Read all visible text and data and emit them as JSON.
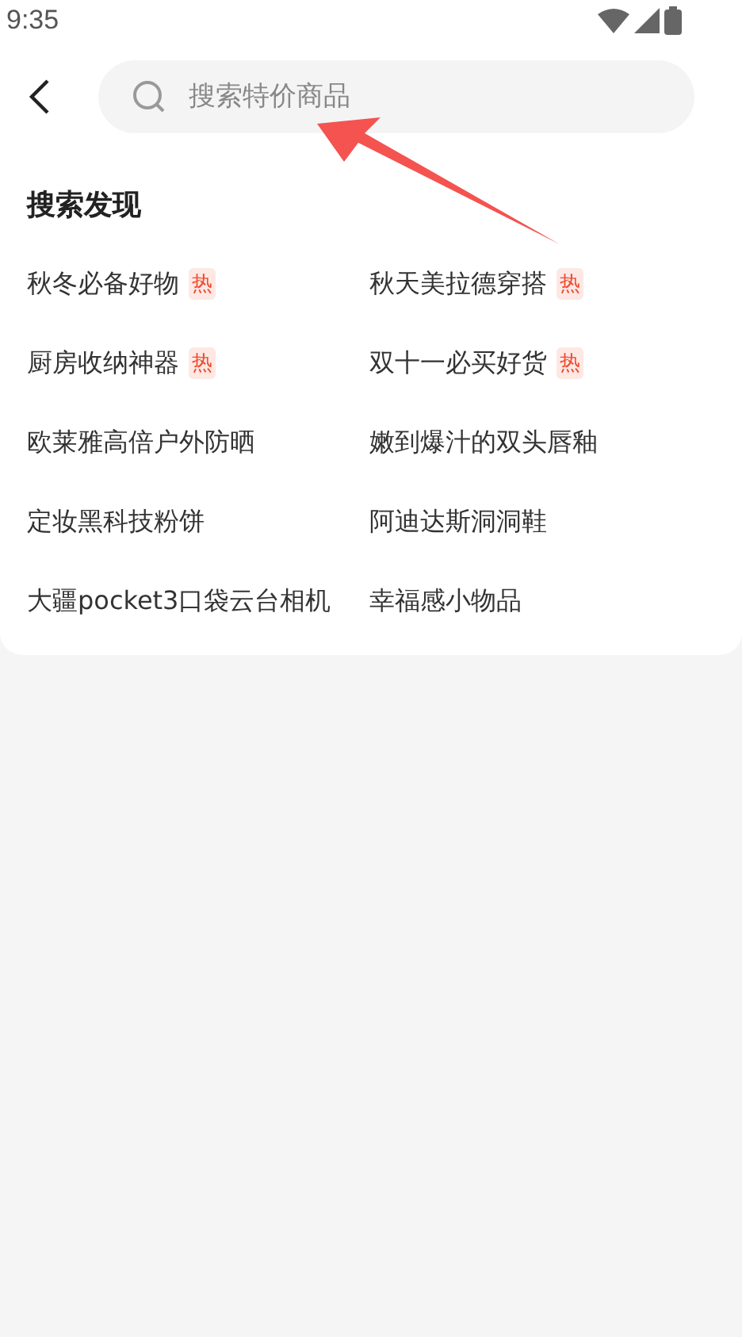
{
  "status_bar": {
    "time": "9:35"
  },
  "search": {
    "placeholder": "搜索特价商品"
  },
  "discover": {
    "title": "搜索发现",
    "items": [
      {
        "label": "秋冬必备好物",
        "badge": "热"
      },
      {
        "label": "秋天美拉德穿搭",
        "badge": "热"
      },
      {
        "label": "厨房收纳神器",
        "badge": "热"
      },
      {
        "label": "双十一必买好货",
        "badge": "热"
      },
      {
        "label": "欧莱雅高倍户外防晒"
      },
      {
        "label": "嫩到爆汁的双头唇釉"
      },
      {
        "label": "定妆黑科技粉饼"
      },
      {
        "label": "阿迪达斯洞洞鞋"
      },
      {
        "label": "大疆pocket3口袋云台相机"
      },
      {
        "label": "幸福感小物品"
      }
    ]
  }
}
